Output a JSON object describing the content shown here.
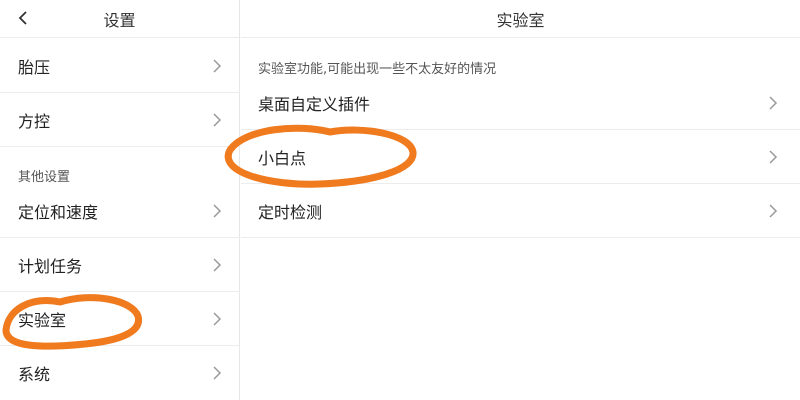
{
  "sidebar": {
    "title": "设置",
    "section_label": "其他设置",
    "items": [
      {
        "label": "胎压"
      },
      {
        "label": "方控"
      },
      {
        "label": "定位和速度"
      },
      {
        "label": "计划任务"
      },
      {
        "label": "实验室"
      },
      {
        "label": "系统"
      }
    ]
  },
  "main": {
    "title": "实验室",
    "description": "实验室功能,可能出现一些不太友好的情况",
    "items": [
      {
        "label": "桌面自定义插件"
      },
      {
        "label": "小白点"
      },
      {
        "label": "定时检测"
      }
    ]
  },
  "colors": {
    "annotation": "#f07a1e",
    "divider": "#ececec",
    "chevron": "#9a9a9a"
  },
  "icons": {
    "back": "chevron-left-icon",
    "row": "chevron-right-icon"
  }
}
